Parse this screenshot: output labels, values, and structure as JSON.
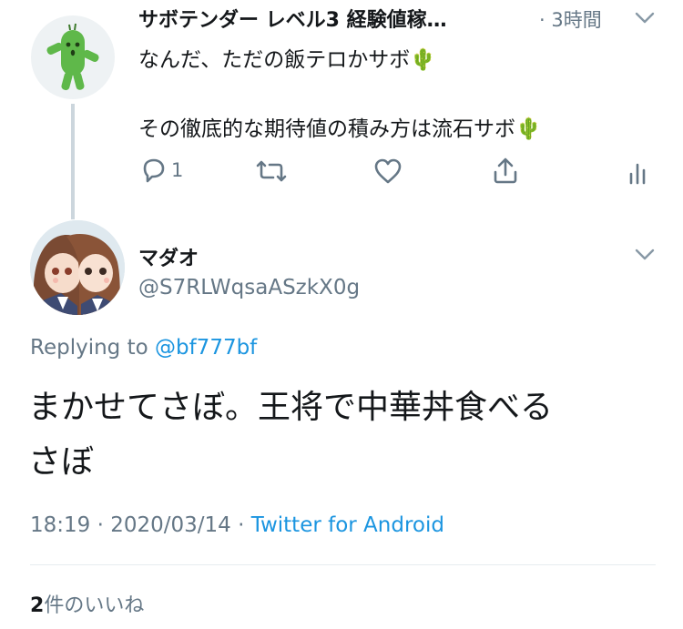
{
  "parent_tweet": {
    "display_name": "サボテンダー レベル3 経験値稼…",
    "time": "· 3時間",
    "avatar_icon": "cactuar-avatar-icon",
    "line1": "なんだ、ただの飯テロかサボ",
    "line2": "その徹底的な期待値の積み方は流石サボ",
    "emoji": "🌵",
    "reply_count": "1",
    "icons": [
      "reply-icon",
      "retweet-icon",
      "like-icon",
      "share-icon",
      "analytics-icon"
    ]
  },
  "reply_tweet": {
    "display_name": "マダオ",
    "handle": "@S7RLWqsaASzkX0g",
    "avatar_icon": "anime-girls-avatar-icon",
    "replying_prefix": "Replying to ",
    "replying_handle": "@bf777bf",
    "body_line1": "まかせてさぼ。王将で中華丼食べる",
    "body_line2": "さぼ",
    "timestamp": "18:19 · 2020/03/14 · ",
    "source": "Twitter for Android",
    "likes_count": "2",
    "likes_label": "件のいいね"
  },
  "colors": {
    "link": "#1b95e0",
    "muted": "#657786",
    "thread_line": "#ccd6dd",
    "divider": "#e6ecf0"
  }
}
